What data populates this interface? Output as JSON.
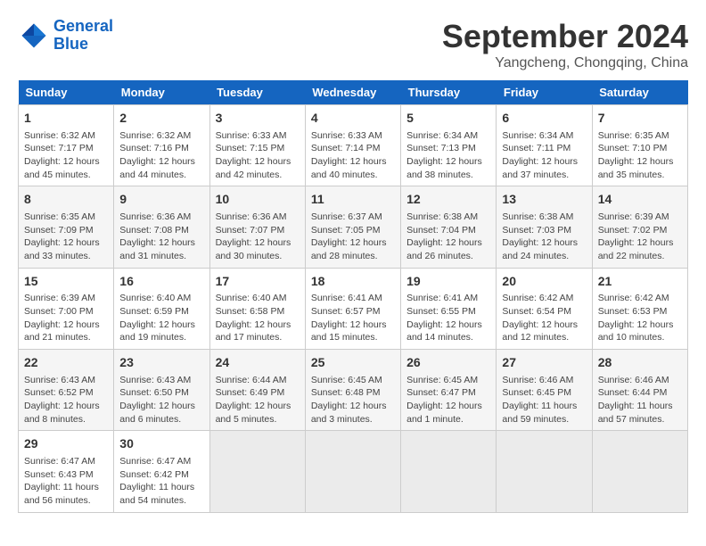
{
  "header": {
    "logo_line1": "General",
    "logo_line2": "Blue",
    "month": "September 2024",
    "location": "Yangcheng, Chongqing, China"
  },
  "days_of_week": [
    "Sunday",
    "Monday",
    "Tuesday",
    "Wednesday",
    "Thursday",
    "Friday",
    "Saturday"
  ],
  "weeks": [
    [
      {
        "day": 1,
        "sunrise": "6:32 AM",
        "sunset": "7:17 PM",
        "daylight": "12 hours and 45 minutes."
      },
      {
        "day": 2,
        "sunrise": "6:32 AM",
        "sunset": "7:16 PM",
        "daylight": "12 hours and 44 minutes."
      },
      {
        "day": 3,
        "sunrise": "6:33 AM",
        "sunset": "7:15 PM",
        "daylight": "12 hours and 42 minutes."
      },
      {
        "day": 4,
        "sunrise": "6:33 AM",
        "sunset": "7:14 PM",
        "daylight": "12 hours and 40 minutes."
      },
      {
        "day": 5,
        "sunrise": "6:34 AM",
        "sunset": "7:13 PM",
        "daylight": "12 hours and 38 minutes."
      },
      {
        "day": 6,
        "sunrise": "6:34 AM",
        "sunset": "7:11 PM",
        "daylight": "12 hours and 37 minutes."
      },
      {
        "day": 7,
        "sunrise": "6:35 AM",
        "sunset": "7:10 PM",
        "daylight": "12 hours and 35 minutes."
      }
    ],
    [
      {
        "day": 8,
        "sunrise": "6:35 AM",
        "sunset": "7:09 PM",
        "daylight": "12 hours and 33 minutes."
      },
      {
        "day": 9,
        "sunrise": "6:36 AM",
        "sunset": "7:08 PM",
        "daylight": "12 hours and 31 minutes."
      },
      {
        "day": 10,
        "sunrise": "6:36 AM",
        "sunset": "7:07 PM",
        "daylight": "12 hours and 30 minutes."
      },
      {
        "day": 11,
        "sunrise": "6:37 AM",
        "sunset": "7:05 PM",
        "daylight": "12 hours and 28 minutes."
      },
      {
        "day": 12,
        "sunrise": "6:38 AM",
        "sunset": "7:04 PM",
        "daylight": "12 hours and 26 minutes."
      },
      {
        "day": 13,
        "sunrise": "6:38 AM",
        "sunset": "7:03 PM",
        "daylight": "12 hours and 24 minutes."
      },
      {
        "day": 14,
        "sunrise": "6:39 AM",
        "sunset": "7:02 PM",
        "daylight": "12 hours and 22 minutes."
      }
    ],
    [
      {
        "day": 15,
        "sunrise": "6:39 AM",
        "sunset": "7:00 PM",
        "daylight": "12 hours and 21 minutes."
      },
      {
        "day": 16,
        "sunrise": "6:40 AM",
        "sunset": "6:59 PM",
        "daylight": "12 hours and 19 minutes."
      },
      {
        "day": 17,
        "sunrise": "6:40 AM",
        "sunset": "6:58 PM",
        "daylight": "12 hours and 17 minutes."
      },
      {
        "day": 18,
        "sunrise": "6:41 AM",
        "sunset": "6:57 PM",
        "daylight": "12 hours and 15 minutes."
      },
      {
        "day": 19,
        "sunrise": "6:41 AM",
        "sunset": "6:55 PM",
        "daylight": "12 hours and 14 minutes."
      },
      {
        "day": 20,
        "sunrise": "6:42 AM",
        "sunset": "6:54 PM",
        "daylight": "12 hours and 12 minutes."
      },
      {
        "day": 21,
        "sunrise": "6:42 AM",
        "sunset": "6:53 PM",
        "daylight": "12 hours and 10 minutes."
      }
    ],
    [
      {
        "day": 22,
        "sunrise": "6:43 AM",
        "sunset": "6:52 PM",
        "daylight": "12 hours and 8 minutes."
      },
      {
        "day": 23,
        "sunrise": "6:43 AM",
        "sunset": "6:50 PM",
        "daylight": "12 hours and 6 minutes."
      },
      {
        "day": 24,
        "sunrise": "6:44 AM",
        "sunset": "6:49 PM",
        "daylight": "12 hours and 5 minutes."
      },
      {
        "day": 25,
        "sunrise": "6:45 AM",
        "sunset": "6:48 PM",
        "daylight": "12 hours and 3 minutes."
      },
      {
        "day": 26,
        "sunrise": "6:45 AM",
        "sunset": "6:47 PM",
        "daylight": "12 hours and 1 minute."
      },
      {
        "day": 27,
        "sunrise": "6:46 AM",
        "sunset": "6:45 PM",
        "daylight": "11 hours and 59 minutes."
      },
      {
        "day": 28,
        "sunrise": "6:46 AM",
        "sunset": "6:44 PM",
        "daylight": "11 hours and 57 minutes."
      }
    ],
    [
      {
        "day": 29,
        "sunrise": "6:47 AM",
        "sunset": "6:43 PM",
        "daylight": "11 hours and 56 minutes."
      },
      {
        "day": 30,
        "sunrise": "6:47 AM",
        "sunset": "6:42 PM",
        "daylight": "11 hours and 54 minutes."
      },
      null,
      null,
      null,
      null,
      null
    ]
  ]
}
